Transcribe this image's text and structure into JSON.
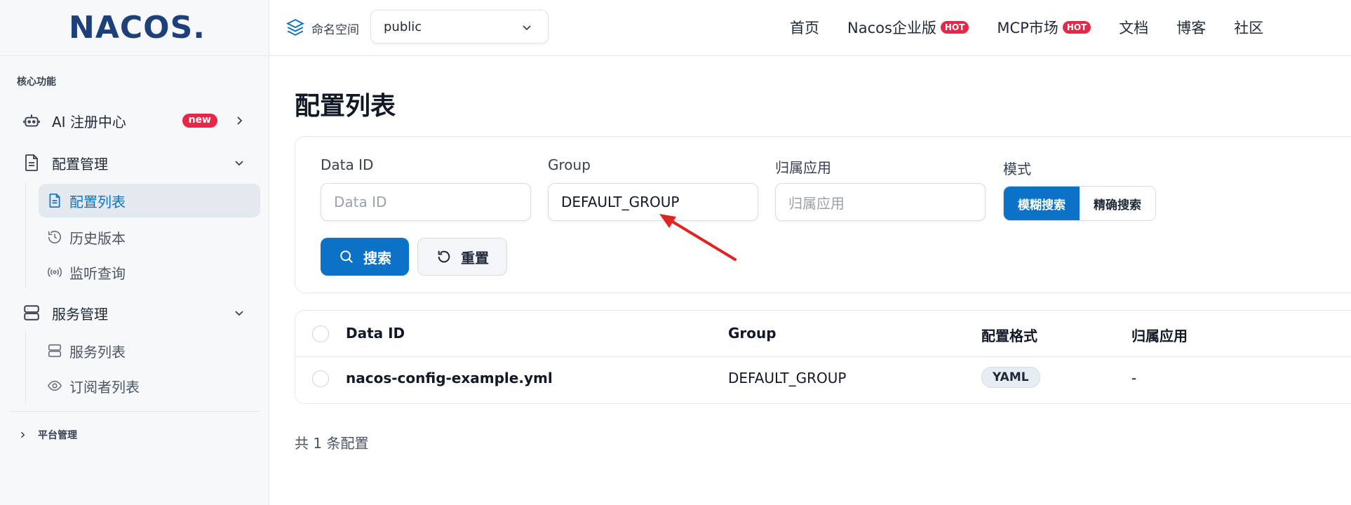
{
  "brand": {
    "logo_text": "NACOS."
  },
  "sidebar": {
    "section_title": "核心功能",
    "items": [
      {
        "label": "AI 注册中心",
        "badge": "new"
      },
      {
        "label": "配置管理"
      },
      {
        "label": "服务管理"
      }
    ],
    "config_sub": [
      {
        "label": "配置列表"
      },
      {
        "label": "历史版本"
      },
      {
        "label": "监听查询"
      }
    ],
    "service_sub": [
      {
        "label": "服务列表"
      },
      {
        "label": "订阅者列表"
      }
    ],
    "platform": "平台管理"
  },
  "topbar": {
    "namespace_label": "命名空间",
    "namespace_value": "public",
    "nav": [
      {
        "label": "首页"
      },
      {
        "label": "Nacos企业版",
        "badge": "HOT"
      },
      {
        "label": "MCP市场",
        "badge": "HOT"
      },
      {
        "label": "文档"
      },
      {
        "label": "博客"
      },
      {
        "label": "社区"
      }
    ]
  },
  "main": {
    "title": "配置列表",
    "filters": {
      "data_id_label": "Data ID",
      "data_id_placeholder": "Data ID",
      "group_label": "Group",
      "group_value": "DEFAULT_GROUP",
      "app_label": "归属应用",
      "app_placeholder": "归属应用",
      "mode_label": "模式",
      "mode_fuzzy": "模糊搜索",
      "mode_exact": "精确搜索",
      "search_button": "搜索",
      "reset_button": "重置"
    },
    "table": {
      "headers": [
        "Data ID",
        "Group",
        "配置格式",
        "归属应用"
      ],
      "rows": [
        {
          "data_id": "nacos-config-example.yml",
          "group": "DEFAULT_GROUP",
          "format": "YAML",
          "app": "-"
        }
      ]
    },
    "total": "共 1 条配置"
  },
  "colors": {
    "primary": "#0b72c7",
    "badge": "#e5284a",
    "arrow": "#e02424"
  }
}
